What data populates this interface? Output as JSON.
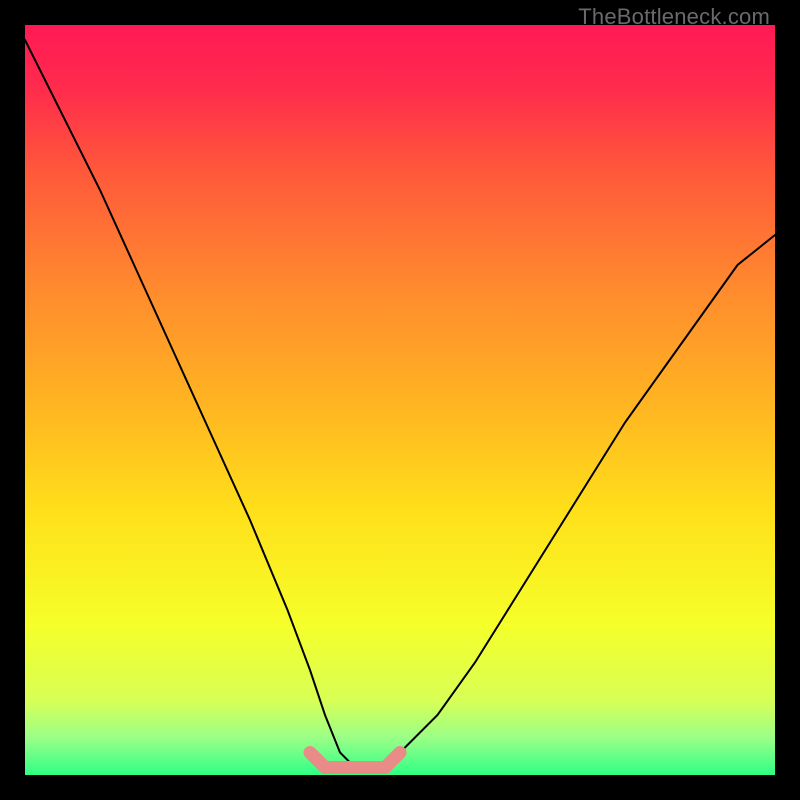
{
  "watermark": "TheBottleneck.com",
  "colors": {
    "frame": "#000000",
    "gradient_stops": [
      {
        "pos": 0.0,
        "color": "#ff1a55"
      },
      {
        "pos": 0.08,
        "color": "#ff2a4d"
      },
      {
        "pos": 0.2,
        "color": "#ff5a3a"
      },
      {
        "pos": 0.35,
        "color": "#ff8a2e"
      },
      {
        "pos": 0.5,
        "color": "#ffb322"
      },
      {
        "pos": 0.65,
        "color": "#ffe01a"
      },
      {
        "pos": 0.8,
        "color": "#f5ff2a"
      },
      {
        "pos": 0.9,
        "color": "#d8ff55"
      },
      {
        "pos": 0.95,
        "color": "#9bff86"
      },
      {
        "pos": 1.0,
        "color": "#2fff86"
      }
    ],
    "curve": "#000000",
    "highlight": "#e98b86"
  },
  "chart_data": {
    "type": "line",
    "title": "",
    "xlabel": "",
    "ylabel": "",
    "xlim": [
      0,
      100
    ],
    "ylim": [
      0,
      100
    ],
    "series": [
      {
        "name": "bottleneck-curve",
        "x": [
          0,
          5,
          10,
          15,
          20,
          25,
          30,
          35,
          38,
          40,
          42,
          44,
          46,
          48,
          50,
          55,
          60,
          65,
          70,
          75,
          80,
          85,
          90,
          95,
          100
        ],
        "y": [
          98,
          88,
          78,
          67,
          56,
          45,
          34,
          22,
          14,
          8,
          3,
          1,
          1,
          1,
          3,
          8,
          15,
          23,
          31,
          39,
          47,
          54,
          61,
          68,
          72
        ]
      },
      {
        "name": "optimal-flat-band",
        "x": [
          38,
          40,
          42,
          44,
          46,
          48,
          50
        ],
        "y": [
          3,
          1,
          1,
          1,
          1,
          1,
          3
        ]
      }
    ],
    "annotations": []
  }
}
